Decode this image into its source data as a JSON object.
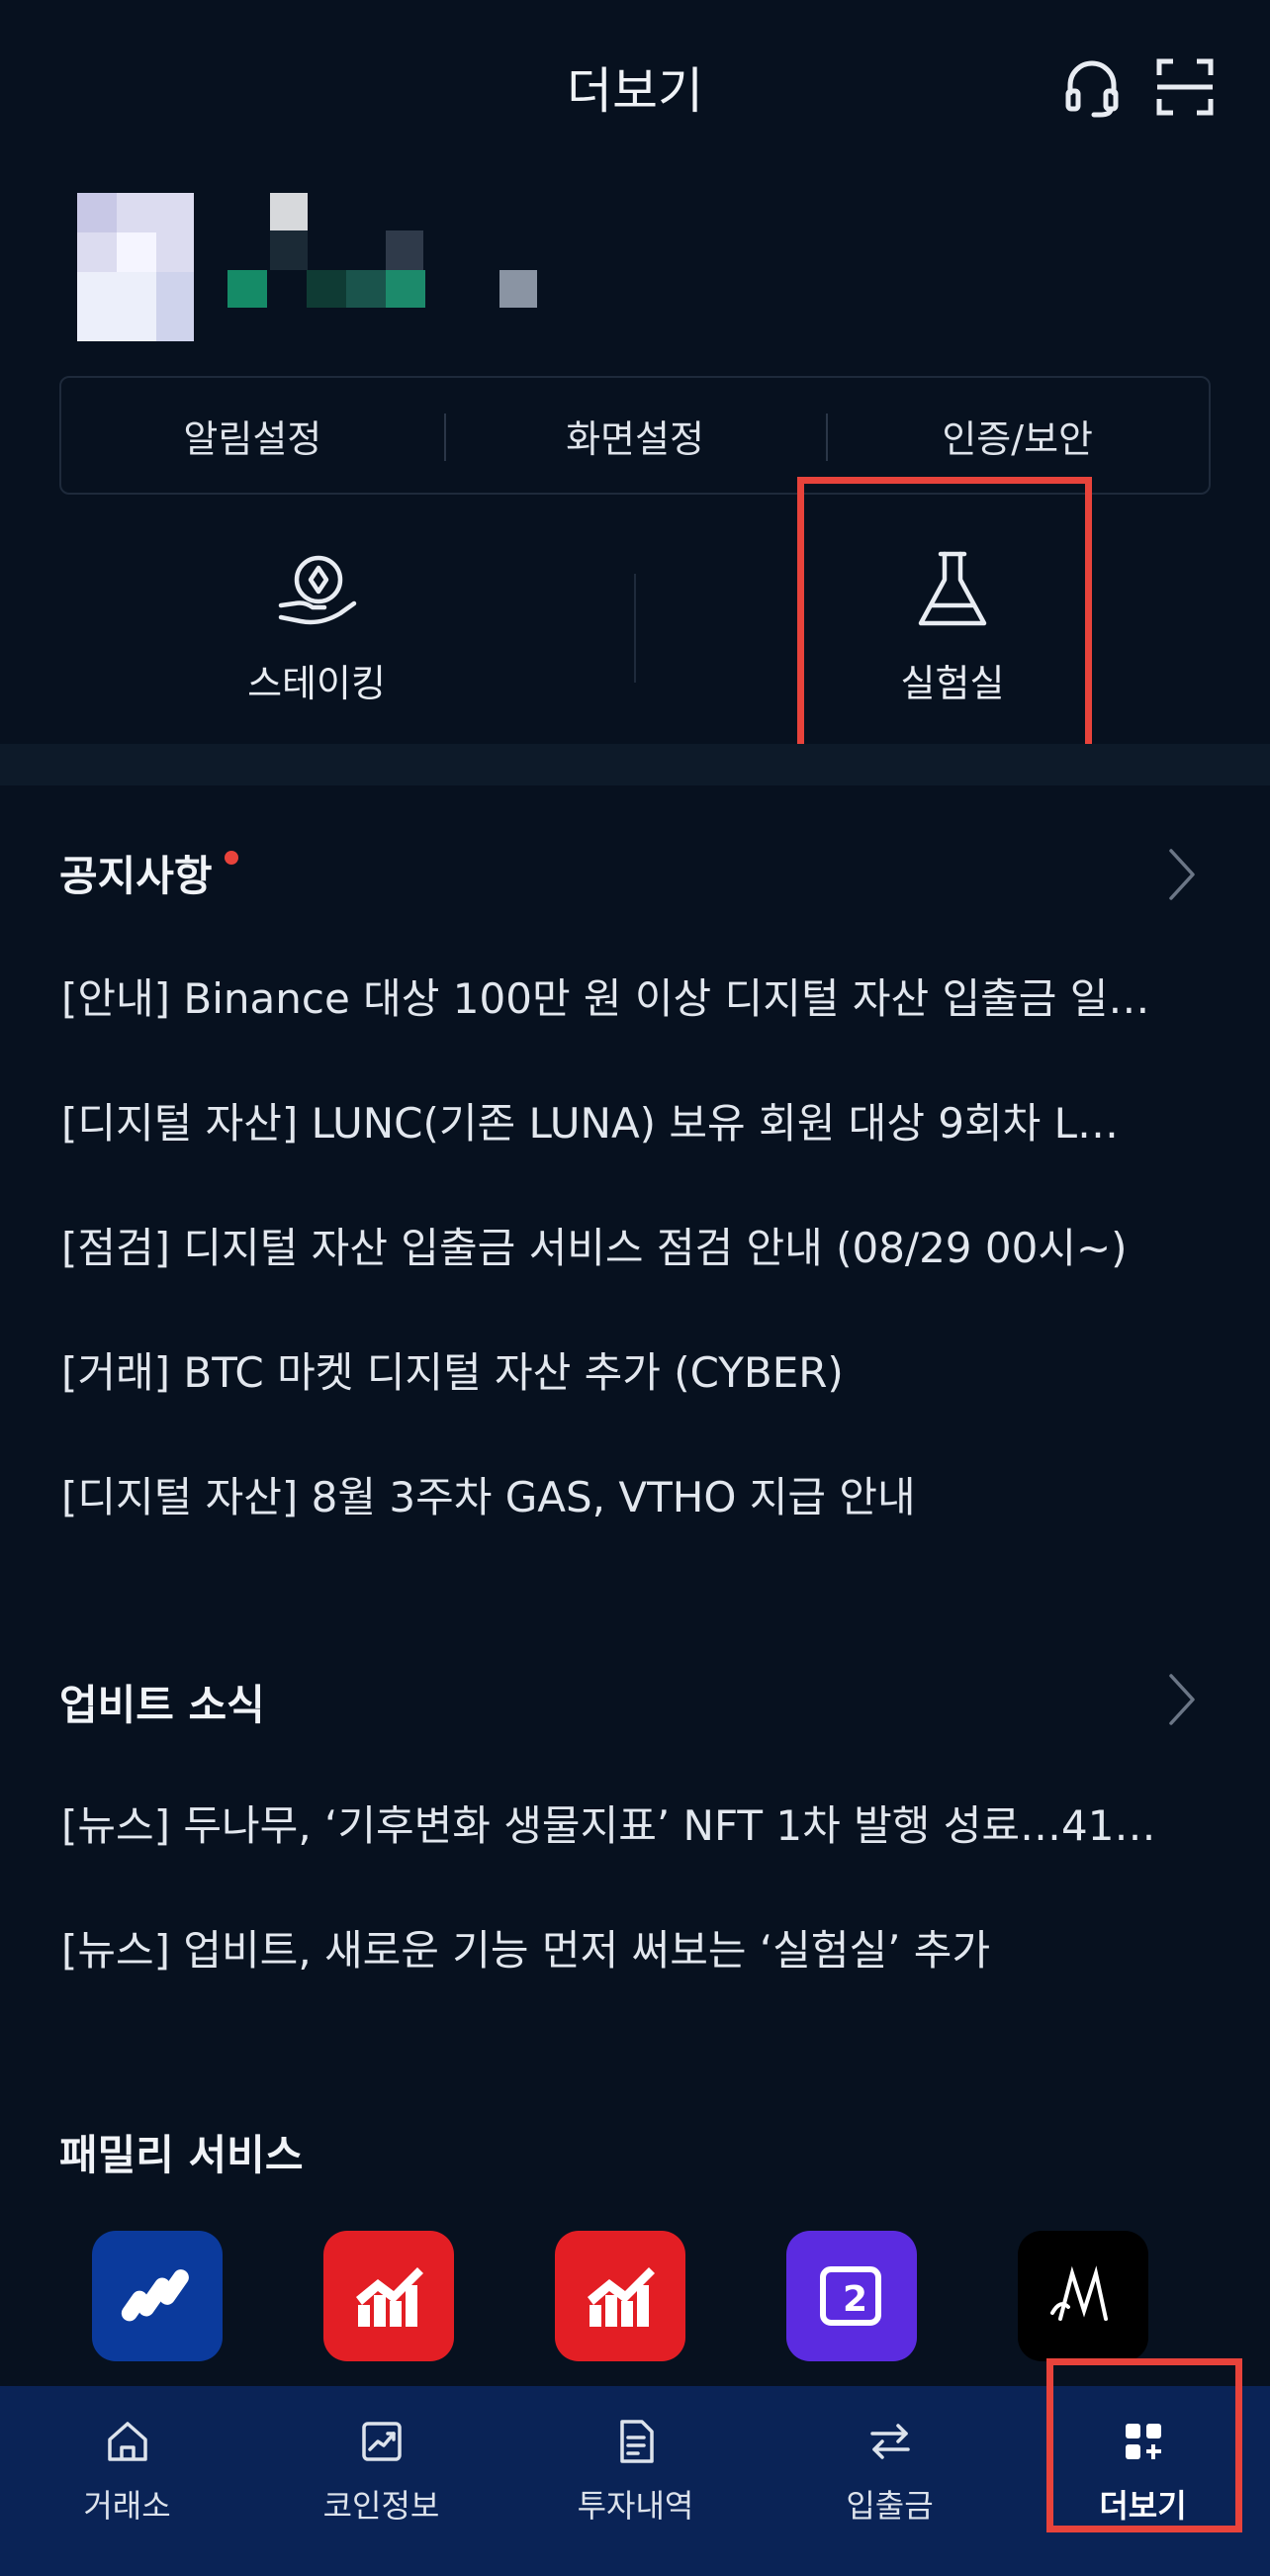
{
  "header": {
    "title": "더보기",
    "support_icon": "headset-icon",
    "scan_icon": "scan-icon"
  },
  "settings": {
    "items": [
      {
        "label": "알림설정"
      },
      {
        "label": "화면설정"
      },
      {
        "label": "인증/보안"
      }
    ]
  },
  "shortcuts": {
    "items": [
      {
        "label": "스테이킹",
        "icon": "staking-coin-hand-icon"
      },
      {
        "label": "실험실",
        "icon": "flask-icon"
      }
    ]
  },
  "notices": {
    "title": "공지사항",
    "items": [
      "[안내] Binance 대상 100만 원 이상 디지털 자산 입출금 일…",
      "[디지털 자산] LUNC(기존 LUNA) 보유 회원 대상 9회차 L…",
      "[점검] 디지털 자산 입출금 서비스 점검 안내 (08/29 00시~)",
      "[거래] BTC 마켓 디지털 자산 추가 (CYBER)",
      "[디지털 자산] 8월 3주차 GAS, VTHO 지급 안내"
    ]
  },
  "upbit_news": {
    "title": "업비트 소식",
    "items": [
      "[뉴스] 두나무, ‘기후변화 생물지표’ NFT 1차 발행 성료…41…",
      "[뉴스] 업비트, 새로운 기능 먼저 써보는 ‘실험실’ 추가"
    ]
  },
  "family": {
    "title": "패밀리 서비스",
    "apps": [
      {
        "icon": "dunamu-app-icon",
        "color": "#0b3a9c"
      },
      {
        "icon": "stock-chart-app-icon",
        "color": "#e31e24"
      },
      {
        "icon": "stock-chart-app-icon-2",
        "color": "#e31e24"
      },
      {
        "icon": "second-app-icon",
        "color": "#5b2be0"
      },
      {
        "icon": "m-logo-app-icon",
        "color": "#000000"
      }
    ]
  },
  "tabbar": {
    "tabs": [
      {
        "label": "거래소",
        "icon": "home-icon"
      },
      {
        "label": "코인정보",
        "icon": "chart-icon"
      },
      {
        "label": "투자내역",
        "icon": "document-icon"
      },
      {
        "label": "입출금",
        "icon": "transfer-icon"
      },
      {
        "label": "더보기",
        "icon": "more-grid-icon",
        "active": true
      }
    ]
  }
}
